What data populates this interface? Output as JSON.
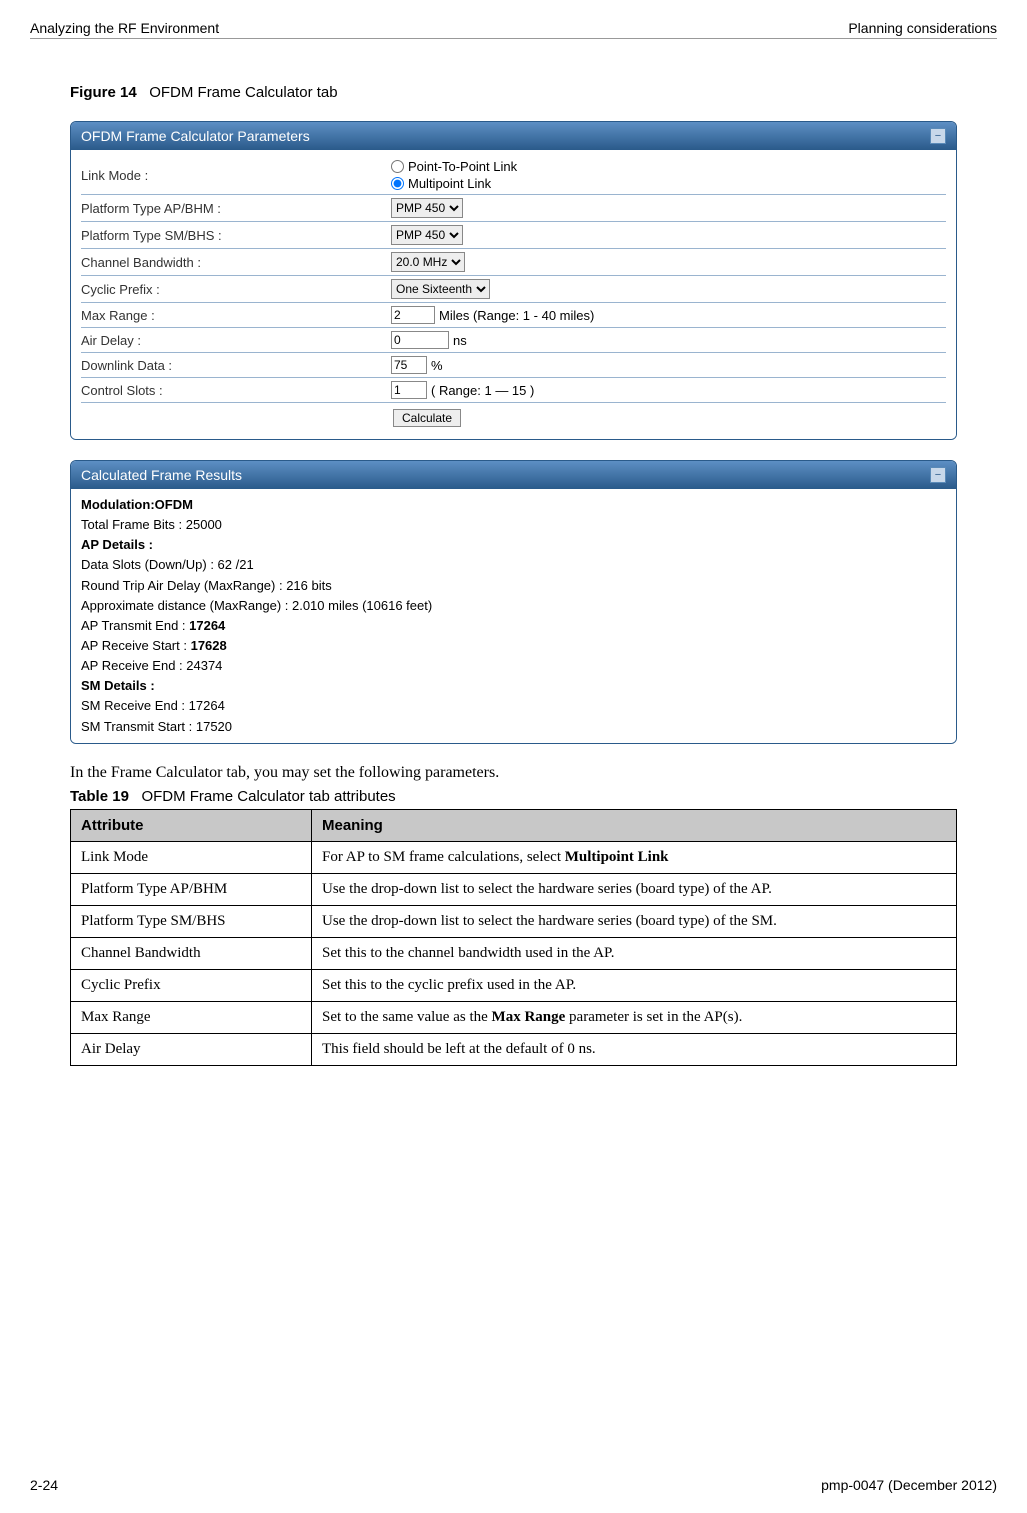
{
  "header": {
    "left": "Analyzing the RF Environment",
    "right": "Planning considerations"
  },
  "figure": {
    "label": "Figure 14",
    "title": "OFDM Frame Calculator tab"
  },
  "panel1": {
    "title": "OFDM Frame Calculator Parameters",
    "rows": {
      "link_mode": {
        "label": "Link Mode :",
        "opt1": "Point-To-Point Link",
        "opt2": "Multipoint Link"
      },
      "platform_ap": {
        "label": "Platform Type AP/BHM :",
        "value": "PMP 450"
      },
      "platform_sm": {
        "label": "Platform Type SM/BHS :",
        "value": "PMP 450"
      },
      "channel_bw": {
        "label": "Channel Bandwidth :",
        "value": "20.0 MHz"
      },
      "cyclic_prefix": {
        "label": "Cyclic Prefix :",
        "value": "One Sixteenth"
      },
      "max_range": {
        "label": "Max Range :",
        "value": "2",
        "suffix": "Miles (Range: 1 - 40 miles)"
      },
      "air_delay": {
        "label": "Air Delay :",
        "value": "0",
        "suffix": "ns"
      },
      "downlink": {
        "label": "Downlink Data :",
        "value": "75",
        "suffix": "%"
      },
      "control_slots": {
        "label": "Control Slots :",
        "value": "1",
        "suffix": "( Range: 1 — 15 )"
      }
    },
    "calculate": "Calculate"
  },
  "panel2": {
    "title": "Calculated Frame Results",
    "lines": {
      "l1": "Modulation:OFDM",
      "l2": "Total Frame Bits : 25000",
      "l3": "AP Details :",
      "l4": "Data Slots (Down/Up) : 62 /21",
      "l5": "Round Trip Air Delay (MaxRange) : 216 bits",
      "l6": "Approximate distance (MaxRange) : 2.010 miles (10616 feet)",
      "l7a": "AP Transmit End : ",
      "l7b": "17264",
      "l8a": "AP Receive Start : ",
      "l8b": "17628",
      "l9": "AP Receive End : 24374",
      "l10": "SM Details :",
      "l11": "SM Receive End : 17264",
      "l12": "SM Transmit Start : 17520"
    }
  },
  "intro": "In the Frame Calculator tab, you may set the following parameters.",
  "table_caption": {
    "label": "Table 19",
    "title": "OFDM Frame Calculator tab attributes"
  },
  "table": {
    "h1": "Attribute",
    "h2": "Meaning",
    "rows": [
      {
        "attr": "Link Mode",
        "mean_pre": "For AP to SM frame calculations, select ",
        "mean_bold": "Multipoint Link",
        "mean_post": ""
      },
      {
        "attr": "Platform Type AP/BHM",
        "mean_pre": "Use the drop-down list to select the hardware series (board type) of the AP.",
        "mean_bold": "",
        "mean_post": ""
      },
      {
        "attr": "Platform Type SM/BHS",
        "mean_pre": "Use the drop-down list to select the hardware series (board type) of the SM.",
        "mean_bold": "",
        "mean_post": ""
      },
      {
        "attr": "Channel Bandwidth",
        "mean_pre": "Set this to the channel bandwidth used in the AP.",
        "mean_bold": "",
        "mean_post": ""
      },
      {
        "attr": "Cyclic Prefix",
        "mean_pre": "Set this to the cyclic prefix used in the AP.",
        "mean_bold": "",
        "mean_post": ""
      },
      {
        "attr": "Max Range",
        "mean_pre": "Set to the same value as the ",
        "mean_bold": "Max Range",
        "mean_post": " parameter is set in the AP(s)."
      },
      {
        "attr": "Air Delay",
        "mean_pre": "This field should be left at the default of 0 ns.",
        "mean_bold": "",
        "mean_post": ""
      }
    ]
  },
  "footer": {
    "left": "2-24",
    "right": "pmp-0047 (December 2012)"
  }
}
